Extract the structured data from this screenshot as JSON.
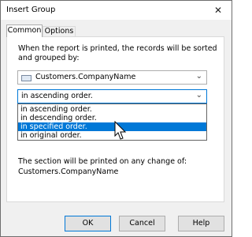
{
  "window": {
    "title": "Insert Group",
    "close_glyph": "✕"
  },
  "tabs": [
    {
      "label": "Common",
      "selected": true
    },
    {
      "label": "Options",
      "selected": false
    }
  ],
  "description": "When the report is printed, the records will be sorted and grouped by:",
  "field": {
    "value": "Customers.CompanyName",
    "icon": "database-field-icon"
  },
  "order": {
    "value": "in ascending order.",
    "options": [
      "in ascending order.",
      "in descending order.",
      "in specified order.",
      "in original order."
    ],
    "highlighted_index": 2
  },
  "note": {
    "line1": "The section will be printed on any change of:",
    "line2": "Customers.CompanyName"
  },
  "buttons": {
    "ok": "OK",
    "cancel": "Cancel",
    "help": "Help"
  },
  "colors": {
    "accent": "#0078d7",
    "window_bg": "#f0f0f0",
    "panel_bg": "#ffffff"
  }
}
